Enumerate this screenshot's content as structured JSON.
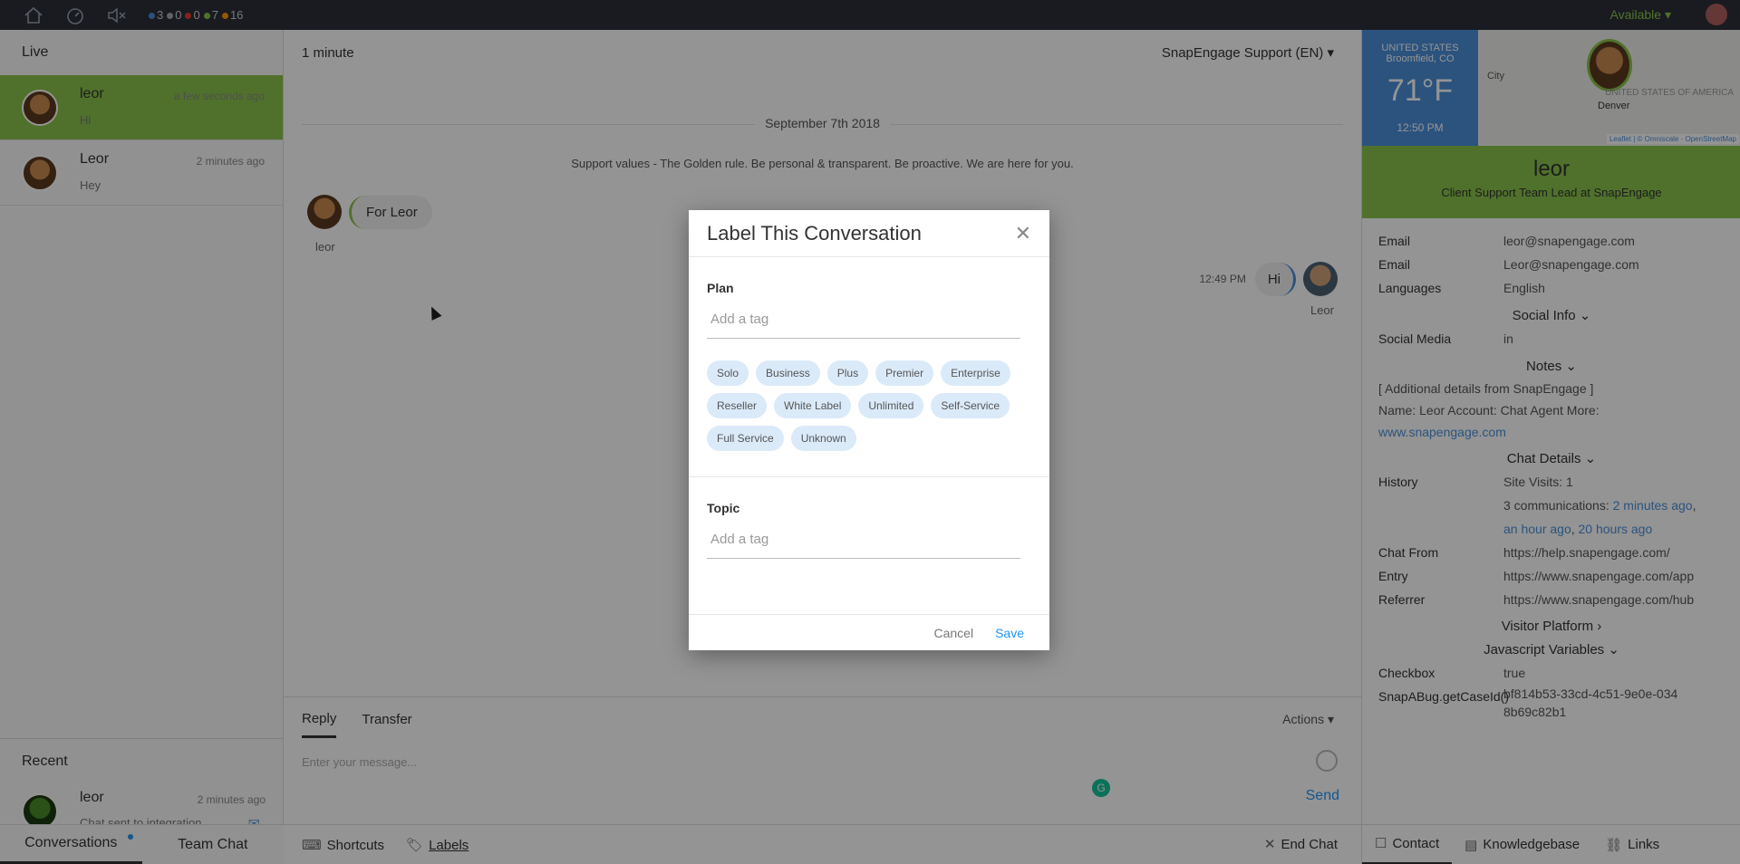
{
  "topbar": {
    "counts": [
      {
        "value": "3",
        "color": "#4a90d9"
      },
      {
        "value": "0",
        "color": "#aaaaaa"
      },
      {
        "value": "0",
        "color": "#e53935"
      },
      {
        "value": "7",
        "color": "#8bc34a"
      },
      {
        "value": "16",
        "color": "#ff9800"
      }
    ],
    "status": "Available",
    "status_color": "#8bc34a"
  },
  "left": {
    "live_title": "Live",
    "live_chats": [
      {
        "name": "leor",
        "time": "a few seconds ago",
        "message": "Hi"
      },
      {
        "name": "Leor",
        "time": "2 minutes ago",
        "message": "Hey"
      }
    ],
    "recent_title": "Recent",
    "recent_chats": [
      {
        "name": "leor",
        "time": "2 minutes ago",
        "message": "Chat sent to integration"
      }
    ],
    "tabs": {
      "conversations": "Conversations",
      "team_chat": "Team Chat"
    }
  },
  "center": {
    "duration": "1 minute",
    "queue": "SnapEngage Support (EN)",
    "date": "September 7th 2018",
    "support_values": "Support values - The Golden rule. Be personal & transparent. Be proactive. We are here for you.",
    "incoming": {
      "text": "For Leor",
      "name": "leor"
    },
    "outgoing": {
      "time": "12:49 PM",
      "text": "Hi",
      "name": "Leor"
    },
    "reply_tabs": {
      "reply": "Reply",
      "transfer": "Transfer"
    },
    "actions": "Actions",
    "message_placeholder": "Enter your message...",
    "send": "Send",
    "bottom": {
      "shortcuts": "Shortcuts",
      "labels": "Labels",
      "end_chat": "End Chat"
    }
  },
  "right": {
    "weather": {
      "country": "UNITED STATES",
      "city": "Broomfield, CO",
      "temp": "71°F",
      "time": "12:50 PM"
    },
    "map": {
      "city_label": "City",
      "denver": "Denver",
      "us_label": "UNITED STATES OF AMERICA",
      "attribution": "Leaflet | © Omniscale · OpenStreetMap"
    },
    "profile": {
      "name": "leor",
      "title": "Client Support Team Lead at SnapEngage"
    },
    "contact": [
      {
        "key": "Email",
        "value": "leor@snapengage.com"
      },
      {
        "key": "Email",
        "value": "Leor@snapengage.com"
      },
      {
        "key": "Languages",
        "value": "English"
      }
    ],
    "social_info": "Social Info",
    "social_media": "Social Media",
    "social_icon": "linkedin-icon",
    "notes_title": "Notes",
    "notes": [
      "[ Additional details from SnapEngage ]",
      "Name: Leor Account: Chat Agent More:"
    ],
    "notes_link": "www.snapengage.com",
    "chat_details": "Chat Details",
    "history_key": "History",
    "history_visits": "Site Visits: 1",
    "history_comms": "3 communications:",
    "history_links": [
      "2 minutes ago",
      "an hour ago",
      "20 hours ago"
    ],
    "chat_from": {
      "key": "Chat From",
      "value": "https://help.snapengage.com/"
    },
    "entry": {
      "key": "Entry",
      "value": "https://www.snapengage.com/app"
    },
    "referrer": {
      "key": "Referrer",
      "value": "https://www.snapengage.com/hub"
    },
    "visitor_platform": "Visitor Platform",
    "js_variables": "Javascript Variables",
    "checkbox": {
      "key": "Checkbox",
      "value": "true"
    },
    "caseid": {
      "key": "SnapABug.getCaseId()",
      "value": "bf814b53-33cd-4c51-9e0e-0348b69c82b1"
    },
    "tabs": {
      "contact": "Contact",
      "knowledgebase": "Knowledgebase",
      "links": "Links"
    }
  },
  "modal": {
    "title": "Label This Conversation",
    "plan_label": "Plan",
    "plan_placeholder": "Add a tag",
    "plan_tags": [
      "Solo",
      "Business",
      "Plus",
      "Premier",
      "Enterprise",
      "Reseller",
      "White Label",
      "Unlimited",
      "Self-Service",
      "Full Service",
      "Unknown"
    ],
    "topic_label": "Topic",
    "topic_placeholder": "Add a tag",
    "cancel": "Cancel",
    "save": "Save"
  }
}
